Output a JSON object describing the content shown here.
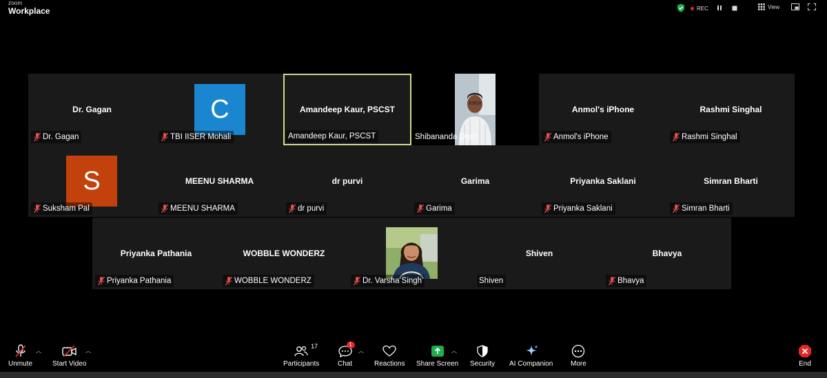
{
  "app": {
    "brand_small": "zoom",
    "brand_large": "Workplace"
  },
  "top_controls": {
    "rec": "REC",
    "view": "View"
  },
  "colors": {
    "active_border": "#d4d98b",
    "mic_off": "#e0524a",
    "share_green": "#1fae4b",
    "end_red": "#e02828",
    "avatar_blue": "#1a86d0",
    "avatar_orange": "#c2410c"
  },
  "tiles": [
    {
      "center": "Dr. Gagan",
      "label": "Dr. Gagan"
    },
    {
      "avatar": "C",
      "label": "TBI IISER Mohali"
    },
    {
      "center": "Amandeep Kaur, PSCST",
      "label": "Amandeep Kaur, PSCST"
    },
    {
      "photo": "man",
      "label": "Shibananda Dash"
    },
    {
      "center": "Anmol's iPhone",
      "label": "Anmol's iPhone"
    },
    {
      "center": "Rashmi Singhal",
      "label": "Rashmi Singhal"
    },
    {
      "avatar": "S",
      "label": "Suksham Pal"
    },
    {
      "center": "MEENU SHARMA",
      "label": "MEENU SHARMA"
    },
    {
      "center": "dr purvi",
      "label": "dr purvi"
    },
    {
      "center": "Garima",
      "label": "Garima"
    },
    {
      "center": "Priyanka Saklani",
      "label": "Priyanka Saklani"
    },
    {
      "center": "Simran Bharti",
      "label": "Simran Bharti"
    },
    {
      "center": "Priyanka Pathania",
      "label": "Priyanka Pathania"
    },
    {
      "center": "WOBBLE WONDERZ",
      "label": "WOBBLE WONDERZ"
    },
    {
      "photo": "woman",
      "label": "Dr. Varsha Singh"
    },
    {
      "center": "Shiven",
      "label": "Shiven"
    },
    {
      "center": "Bhavya",
      "label": "Bhavya"
    }
  ],
  "toolbar": {
    "unmute": "Unmute",
    "start_video": "Start Video",
    "participants": "Participants",
    "participants_count": "17",
    "chat": "Chat",
    "chat_badge": "1",
    "reactions": "Reactions",
    "share_screen": "Share Screen",
    "security": "Security",
    "ai_companion": "AI Companion",
    "more": "More",
    "end": "End"
  }
}
